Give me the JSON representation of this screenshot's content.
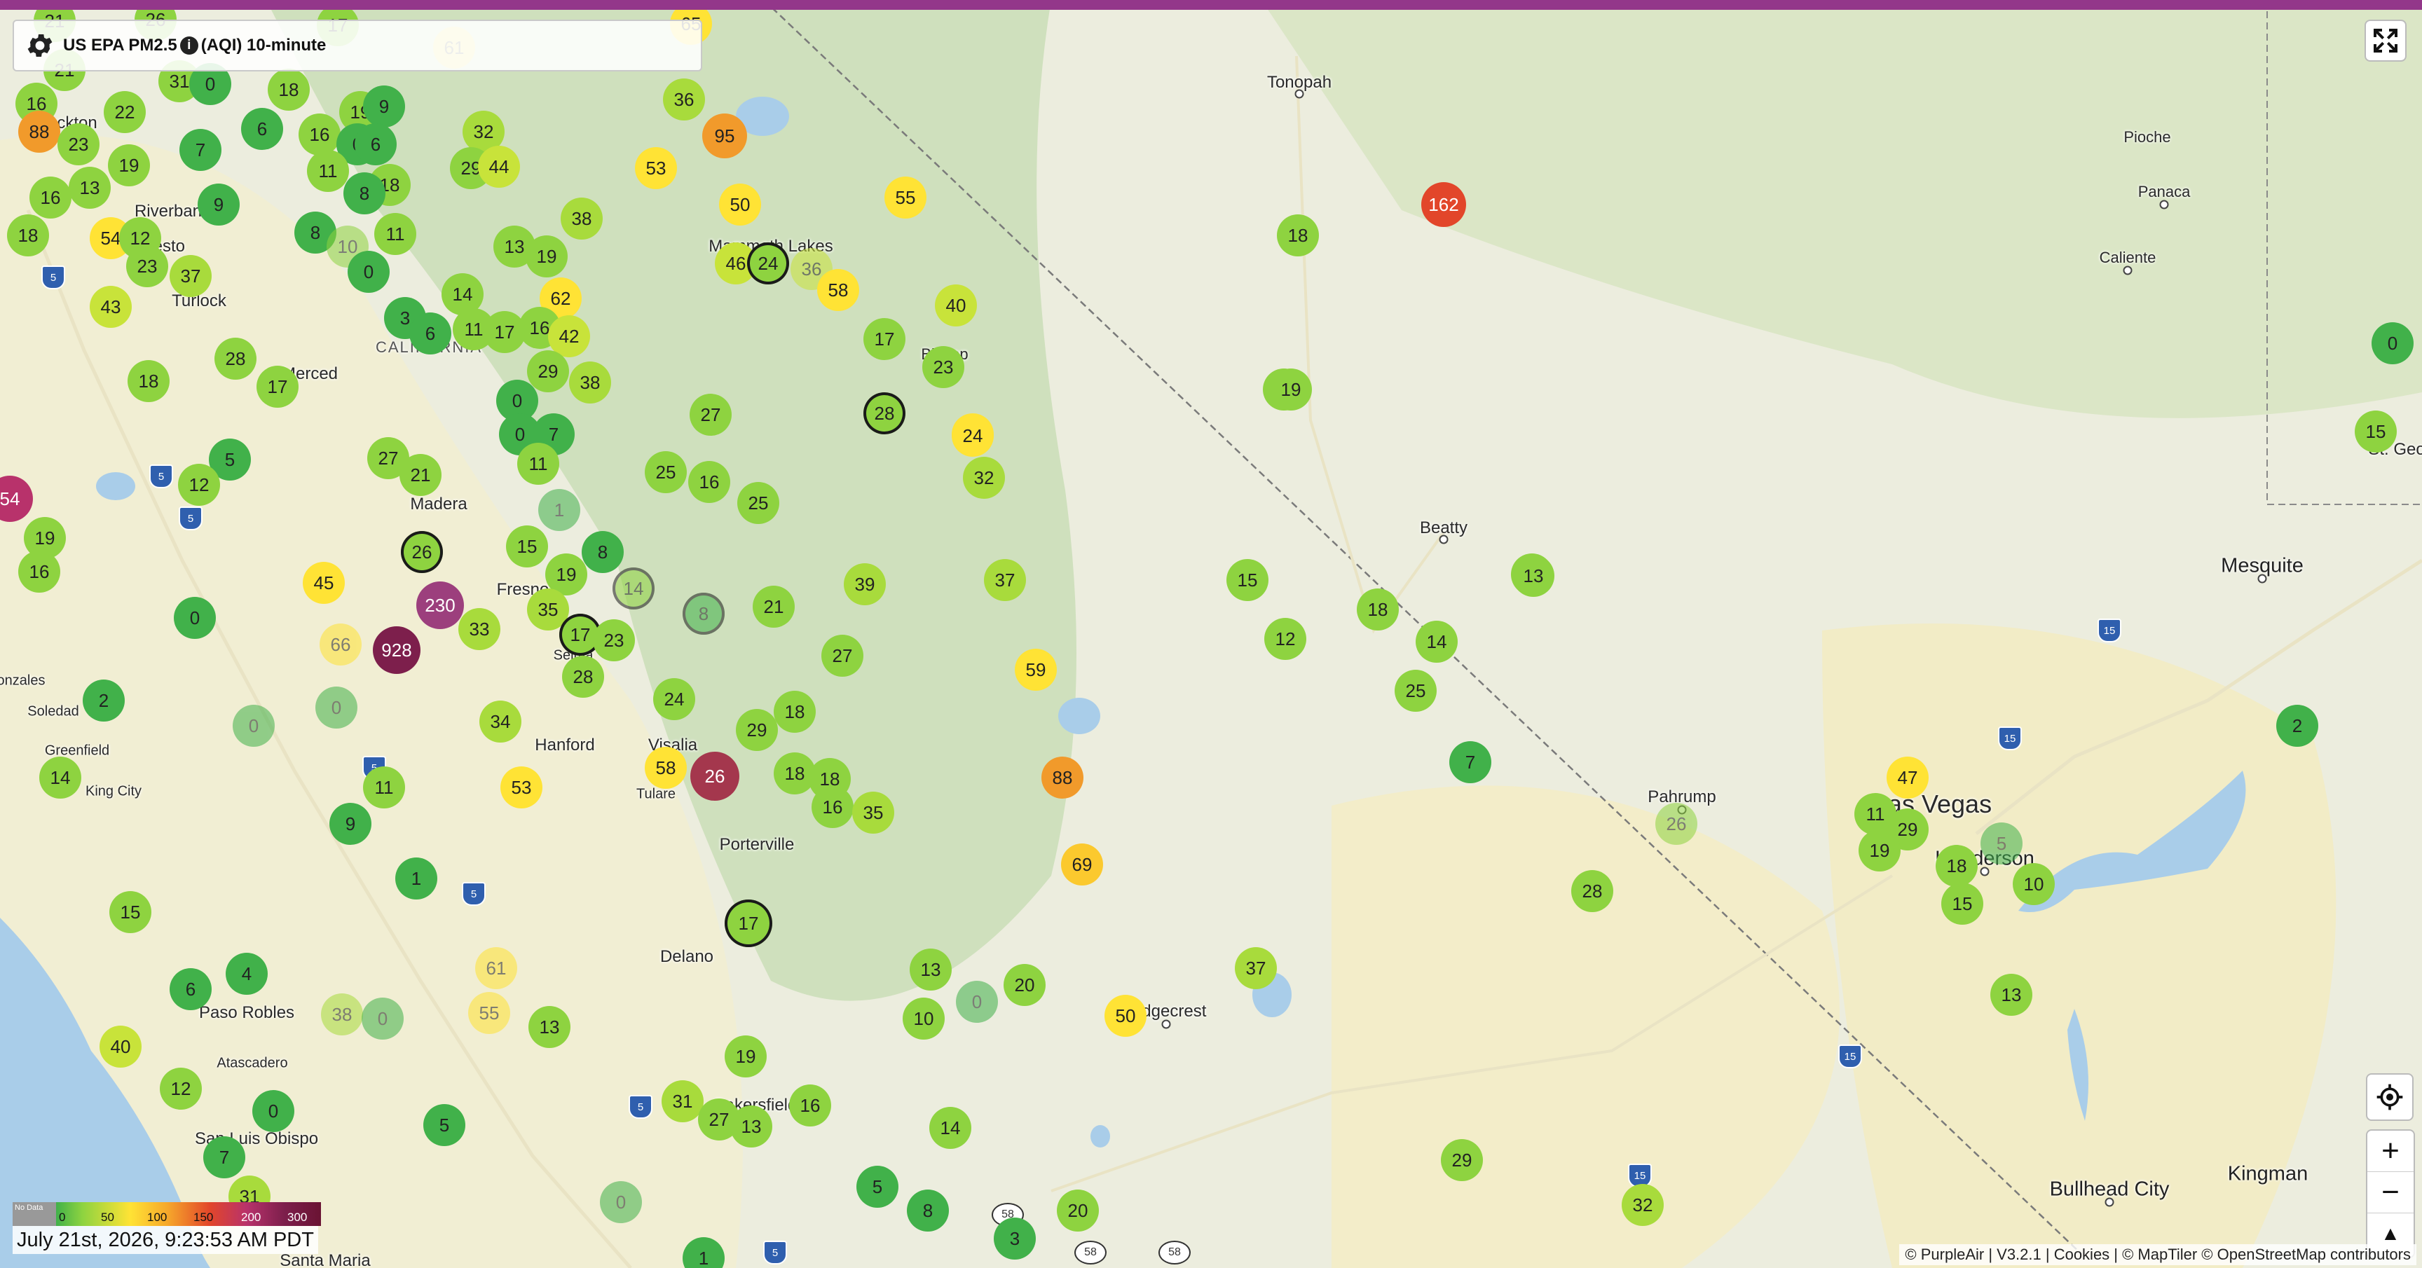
{
  "header": {
    "sensor_type": "US EPA PM2.5",
    "averaging": "(AQI) 10-minute",
    "info_icon": "info-icon",
    "settings_icon": "gear-icon"
  },
  "controls": {
    "fullscreen_icon": "fullscreen-icon",
    "locate_icon": "locate-icon",
    "zoom_in": "+",
    "zoom_out": "−",
    "compass": "▲"
  },
  "legend": {
    "nodata": "No Data",
    "ticks": [
      "0",
      "50",
      "100",
      "150",
      "200",
      "300"
    ]
  },
  "timestamp": "July 21st, 2026, 9:23:53 AM PDT",
  "attribution": "© PurpleAir | V3.2.1 | Cookies | © MapTiler © OpenStreetMap contributors",
  "places": {
    "stockton": "Stockton",
    "riverbank": "Riverbank",
    "modesto": "Modesto",
    "turlock": "Turlock",
    "merced": "Merced",
    "california": "CALIFORNIA",
    "madera": "Madera",
    "fresno": "Fresno",
    "selma": "Selma",
    "hanford": "Hanford",
    "visalia": "Visalia",
    "tulare": "Tulare",
    "porterville": "Porterville",
    "delano": "Delano",
    "bakersfield": "Bakersfield",
    "soledad": "Soledad",
    "greenfield": "Greenfield",
    "king_city": "King City",
    "gonzales": "onzales",
    "paso_robles": "Paso Robles",
    "atascadero": "Atascadero",
    "san_luis_obispo": "San Luis Obispo",
    "santa_maria": "Santa Maria",
    "mammoth_lakes": "Mammoth Lakes",
    "bishop": "Bishop",
    "ridgecrest": "Ridgecrest",
    "tonopah": "Tonopah",
    "beatty": "Beatty",
    "pahrump": "Pahrump",
    "las_vegas": "Las Vegas",
    "henderson": "Henderson",
    "mesquite": "Mesquite",
    "pioche": "Pioche",
    "panaca": "Panaca",
    "caliente": "Caliente",
    "st_george": "St. Geo",
    "bullhead_city": "Bullhead City",
    "kingman": "Kingman"
  },
  "shields": {
    "i5": "5",
    "i15": "15",
    "r58": "58"
  },
  "sensors": [
    {
      "v": "26",
      "c": "#8ed340"
    },
    {
      "v": "21",
      "c": "#8ed340"
    },
    {
      "v": "17",
      "c": "#8ed340"
    },
    {
      "v": "65",
      "c": "#ffe335"
    },
    {
      "v": "61",
      "c": "#ffe335"
    },
    {
      "v": "21",
      "c": "#8ed340"
    },
    {
      "v": "31",
      "c": "#8ed340"
    },
    {
      "v": "0",
      "c": "#41b14a"
    },
    {
      "v": "18",
      "c": "#8ed340"
    },
    {
      "v": "36",
      "c": "#a8db3c"
    },
    {
      "v": "95",
      "c": "#f19a2b"
    },
    {
      "v": "16",
      "c": "#8ed340"
    },
    {
      "v": "22",
      "c": "#8ed340"
    },
    {
      "v": "88",
      "c": "#f19a2b"
    },
    {
      "v": "23",
      "c": "#8ed340"
    },
    {
      "v": "6",
      "c": "#41b14a"
    },
    {
      "v": "19",
      "c": "#8ed340"
    },
    {
      "v": "9",
      "c": "#41b14a"
    },
    {
      "v": "32",
      "c": "#a8db3c"
    },
    {
      "v": "7",
      "c": "#41b14a"
    },
    {
      "v": "16",
      "c": "#8ed340"
    },
    {
      "v": "0",
      "c": "#41b14a"
    },
    {
      "v": "6",
      "c": "#41b14a"
    },
    {
      "v": "19",
      "c": "#8ed340"
    },
    {
      "v": "29",
      "c": "#8ed340"
    },
    {
      "v": "44",
      "c": "#c8e33a"
    },
    {
      "v": "53",
      "c": "#ffe335"
    },
    {
      "v": "13",
      "c": "#8ed340"
    },
    {
      "v": "11",
      "c": "#8ed340"
    },
    {
      "v": "16",
      "c": "#8ed340"
    },
    {
      "v": "18",
      "c": "#8ed340"
    },
    {
      "v": "9",
      "c": "#41b14a"
    },
    {
      "v": "8",
      "c": "#41b14a"
    },
    {
      "v": "50",
      "c": "#ffe335"
    },
    {
      "v": "55",
      "c": "#ffe335"
    },
    {
      "v": "18",
      "c": "#8ed340"
    },
    {
      "v": "162",
      "c": "#e2462a"
    },
    {
      "v": "38",
      "c": "#a8db3c"
    },
    {
      "v": "8",
      "c": "#41b14a"
    },
    {
      "v": "10",
      "c": "#8ed340"
    },
    {
      "v": "11",
      "c": "#8ed340"
    },
    {
      "v": "13",
      "c": "#8ed340"
    },
    {
      "v": "19",
      "c": "#8ed340"
    },
    {
      "v": "46",
      "c": "#c8e33a"
    },
    {
      "v": "24",
      "c": "#8ed340"
    },
    {
      "v": "36",
      "c": "#c8e33a"
    },
    {
      "v": "58",
      "c": "#ffe335"
    },
    {
      "v": "54",
      "c": "#ffe335"
    },
    {
      "v": "12",
      "c": "#8ed340"
    },
    {
      "v": "23",
      "c": "#8ed340"
    },
    {
      "v": "37",
      "c": "#a8db3c"
    },
    {
      "v": "43",
      "c": "#c8e33a"
    },
    {
      "v": "18",
      "c": "#8ed340"
    },
    {
      "v": "14",
      "c": "#8ed340"
    },
    {
      "v": "0",
      "c": "#41b14a"
    },
    {
      "v": "62",
      "c": "#ffe335"
    },
    {
      "v": "40",
      "c": "#c8e33a"
    },
    {
      "v": "3",
      "c": "#41b14a"
    },
    {
      "v": "6",
      "c": "#41b14a"
    },
    {
      "v": "11",
      "c": "#8ed340"
    },
    {
      "v": "17",
      "c": "#8ed340"
    },
    {
      "v": "16",
      "c": "#8ed340"
    },
    {
      "v": "42",
      "c": "#c8e33a"
    },
    {
      "v": "17",
      "c": "#8ed340"
    },
    {
      "v": "28",
      "c": "#8ed340"
    },
    {
      "v": "29",
      "c": "#8ed340"
    },
    {
      "v": "38",
      "c": "#a8db3c"
    },
    {
      "v": "23",
      "c": "#8ed340"
    },
    {
      "v": "18",
      "c": "#8ed340"
    },
    {
      "v": "17",
      "c": "#8ed340"
    },
    {
      "v": "19",
      "c": "#8ed340"
    },
    {
      "v": "0",
      "c": "#41b14a"
    },
    {
      "v": "27",
      "c": "#8ed340"
    },
    {
      "v": "28",
      "c": "#8ed340"
    },
    {
      "v": "24",
      "c": "#ffe335"
    },
    {
      "v": "0",
      "c": "#41b14a"
    },
    {
      "v": "7",
      "c": "#41b14a"
    },
    {
      "v": "27",
      "c": "#8ed340"
    },
    {
      "v": "21",
      "c": "#8ed340"
    },
    {
      "v": "54",
      "c": "#b8326b"
    },
    {
      "v": "5",
      "c": "#41b14a"
    },
    {
      "v": "12",
      "c": "#8ed340"
    },
    {
      "v": "11",
      "c": "#8ed340"
    },
    {
      "v": "25",
      "c": "#8ed340"
    },
    {
      "v": "16",
      "c": "#8ed340"
    },
    {
      "v": "25",
      "c": "#8ed340"
    },
    {
      "v": "32",
      "c": "#a8db3c"
    },
    {
      "v": "19",
      "c": "#8ed340"
    },
    {
      "v": "16",
      "c": "#8ed340"
    },
    {
      "v": "26",
      "c": "#8ed340"
    },
    {
      "v": "1",
      "c": "#41b14a"
    },
    {
      "v": "15",
      "c": "#8ed340"
    },
    {
      "v": "8",
      "c": "#41b14a"
    },
    {
      "v": "45",
      "c": "#ffe335"
    },
    {
      "v": "19",
      "c": "#8ed340"
    },
    {
      "v": "35",
      "c": "#a8db3c"
    },
    {
      "v": "230",
      "c": "#9c3f7d"
    },
    {
      "v": "14",
      "c": "#8ed340"
    },
    {
      "v": "8",
      "c": "#41b14a"
    },
    {
      "v": "21",
      "c": "#8ed340"
    },
    {
      "v": "39",
      "c": "#a8db3c"
    },
    {
      "v": "37",
      "c": "#a8db3c"
    },
    {
      "v": "0",
      "c": "#41b14a"
    },
    {
      "v": "66",
      "c": "#ffe335"
    },
    {
      "v": "928",
      "c": "#7d1f4c"
    },
    {
      "v": "33",
      "c": "#a8db3c"
    },
    {
      "v": "17",
      "c": "#8ed340"
    },
    {
      "v": "23",
      "c": "#8ed340"
    },
    {
      "v": "28",
      "c": "#8ed340"
    },
    {
      "v": "27",
      "c": "#8ed340"
    },
    {
      "v": "59",
      "c": "#ffe335"
    },
    {
      "v": "2",
      "c": "#41b14a"
    },
    {
      "v": "0",
      "c": "#41b14a"
    },
    {
      "v": "34",
      "c": "#a8db3c"
    },
    {
      "v": "24",
      "c": "#8ed340"
    },
    {
      "v": "29",
      "c": "#8ed340"
    },
    {
      "v": "18",
      "c": "#8ed340"
    },
    {
      "v": "0",
      "c": "#41b14a"
    },
    {
      "v": "88",
      "c": "#f19a2b"
    },
    {
      "v": "14",
      "c": "#8ed340"
    },
    {
      "v": "53",
      "c": "#ffe335"
    },
    {
      "v": "58",
      "c": "#ffe335"
    },
    {
      "v": "26",
      "c": "#a4374d"
    },
    {
      "v": "18",
      "c": "#8ed340"
    },
    {
      "v": "16",
      "c": "#8ed340"
    },
    {
      "v": "35",
      "c": "#a8db3c"
    },
    {
      "v": "11",
      "c": "#8ed340"
    },
    {
      "v": "9",
      "c": "#41b14a"
    },
    {
      "v": "1",
      "c": "#41b14a"
    },
    {
      "v": "69",
      "c": "#fbc92e"
    },
    {
      "v": "17",
      "c": "#8ed340"
    },
    {
      "v": "15",
      "c": "#8ed340"
    },
    {
      "v": "4",
      "c": "#41b14a"
    },
    {
      "v": "6",
      "c": "#41b14a"
    },
    {
      "v": "61",
      "c": "#ffe335"
    },
    {
      "v": "13",
      "c": "#8ed340"
    },
    {
      "v": "20",
      "c": "#8ed340"
    },
    {
      "v": "0",
      "c": "#41b14a"
    },
    {
      "v": "38",
      "c": "#a8db3c"
    },
    {
      "v": "0",
      "c": "#41b14a"
    },
    {
      "v": "55",
      "c": "#ffe335"
    },
    {
      "v": "13",
      "c": "#8ed340"
    },
    {
      "v": "10",
      "c": "#8ed340"
    },
    {
      "v": "40",
      "c": "#c8e33a"
    },
    {
      "v": "19",
      "c": "#8ed340"
    },
    {
      "v": "12",
      "c": "#8ed340"
    },
    {
      "v": "0",
      "c": "#41b14a"
    },
    {
      "v": "31",
      "c": "#a8db3c"
    },
    {
      "v": "27",
      "c": "#8ed340"
    },
    {
      "v": "13",
      "c": "#8ed340"
    },
    {
      "v": "16",
      "c": "#8ed340"
    },
    {
      "v": "5",
      "c": "#41b14a"
    },
    {
      "v": "14",
      "c": "#8ed340"
    },
    {
      "v": "5",
      "c": "#41b14a"
    },
    {
      "v": "8",
      "c": "#41b14a"
    },
    {
      "v": "20",
      "c": "#8ed340"
    },
    {
      "v": "3",
      "c": "#41b14a"
    },
    {
      "v": "0",
      "c": "#41b14a"
    },
    {
      "v": "7",
      "c": "#41b14a"
    },
    {
      "v": "31",
      "c": "#a8db3c"
    },
    {
      "v": "1",
      "c": "#41b14a"
    },
    {
      "v": "50",
      "c": "#ffe335"
    },
    {
      "v": "37",
      "c": "#a8db3c"
    },
    {
      "v": "29",
      "c": "#8ed340"
    },
    {
      "v": "18",
      "c": "#8ed340"
    },
    {
      "v": "15",
      "c": "#8ed340"
    },
    {
      "v": "12",
      "c": "#8ed340"
    },
    {
      "v": "14",
      "c": "#8ed340"
    },
    {
      "v": "25",
      "c": "#8ed340"
    },
    {
      "v": "19",
      "c": "#8ed340"
    },
    {
      "v": "13",
      "c": "#8ed340"
    },
    {
      "v": "7",
      "c": "#41b14a"
    },
    {
      "v": "26",
      "c": "#8ed340"
    },
    {
      "v": "28",
      "c": "#8ed340"
    },
    {
      "v": "47",
      "c": "#ffe335"
    },
    {
      "v": "11",
      "c": "#8ed340"
    },
    {
      "v": "29",
      "c": "#8ed340"
    },
    {
      "v": "19",
      "c": "#8ed340"
    },
    {
      "v": "18",
      "c": "#8ed340"
    },
    {
      "v": "5",
      "c": "#41b14a"
    },
    {
      "v": "15",
      "c": "#8ed340"
    },
    {
      "v": "10",
      "c": "#8ed340"
    },
    {
      "v": "13",
      "c": "#8ed340"
    },
    {
      "v": "32",
      "c": "#a8db3c"
    },
    {
      "v": "0",
      "c": "#41b14a"
    },
    {
      "v": "15",
      "c": "#8ed340"
    },
    {
      "v": "2",
      "c": "#41b14a"
    },
    {
      "v": "24",
      "c": "#ffe335"
    },
    {
      "v": "18",
      "c": "#8ed340"
    },
    {
      "v": "13",
      "c": "#8ed340"
    }
  ]
}
